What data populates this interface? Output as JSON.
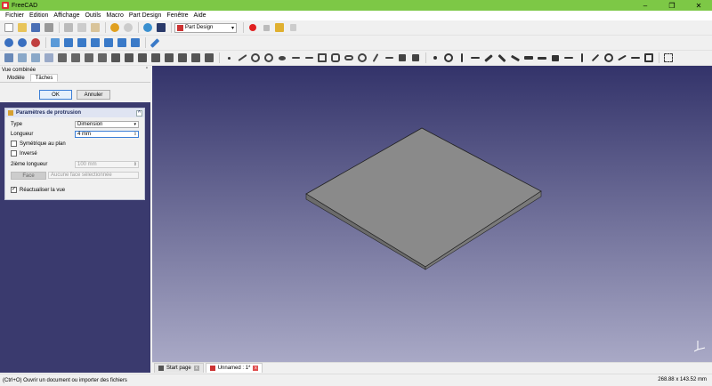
{
  "window": {
    "title": "FreeCAD",
    "minimize_glyph": "–",
    "maximize_glyph": "❐",
    "close_glyph": "✕"
  },
  "menu": [
    "Fichier",
    "Edition",
    "Affichage",
    "Outils",
    "Macro",
    "Part Design",
    "Fenêtre",
    "Aide"
  ],
  "workbench": {
    "selected": "Part Design"
  },
  "combo_view": {
    "title": "Vue combinée",
    "tabs": [
      "Modèle",
      "Tâches"
    ],
    "active_tab": "Tâches",
    "ok_label": "OK",
    "cancel_label": "Annuler",
    "task": {
      "title": "Paramètres de protrusion",
      "type_label": "Type",
      "type_value": "Dimension",
      "length_label": "Longueur",
      "length_value": "4 mm",
      "symmetric_label": "Symétrique au plan",
      "symmetric_checked": false,
      "reversed_label": "Inversé",
      "reversed_checked": false,
      "second_length_label": "2ième longueur",
      "second_length_value": "100 mm",
      "face_button": "Face",
      "face_placeholder": "Aucune face sélectionnée",
      "refine_label": "Réactualiser la vue",
      "refine_checked": true
    }
  },
  "doc_tabs": [
    {
      "label": "Start page",
      "active": false
    },
    {
      "label": "Unnamed : 1*",
      "active": true
    }
  ],
  "status": {
    "message": "(Ctrl+O) Ouvrir un document ou importer des fichiers",
    "dimensions": "268.88 x 143.52 mm"
  },
  "icons": {
    "toolbar1": [
      "new-icon",
      "open-icon",
      "save-icon",
      "print-icon",
      "cut-icon",
      "copy-icon",
      "paste-icon",
      "undo-icon",
      "redo-icon",
      "refresh-icon",
      "whats-this-icon"
    ],
    "toolbar2": [
      "fit-all-icon",
      "fit-selection-icon",
      "draw-style-icon",
      "view-isometric-icon",
      "view-front-icon",
      "view-top-icon",
      "view-right-icon",
      "view-rear-icon",
      "view-bottom-icon",
      "view-left-icon",
      "measure-icon"
    ]
  },
  "colors": {
    "titlebar": "#7dc846",
    "viewport_top": "#33336a",
    "viewport_bottom": "#a9a9c6",
    "record": "#e02020"
  }
}
